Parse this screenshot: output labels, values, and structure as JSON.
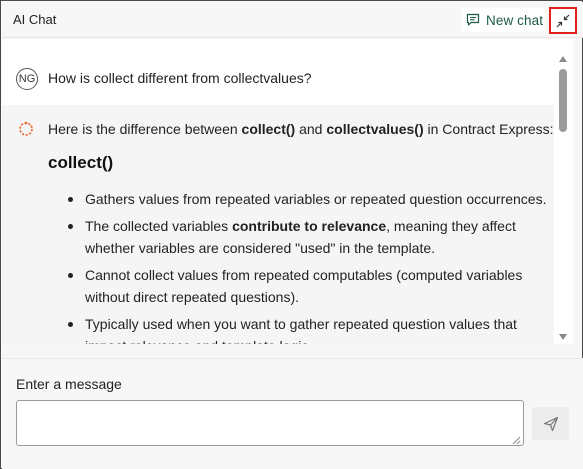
{
  "header": {
    "title": "AI Chat",
    "new_chat_label": "New chat",
    "new_chat_icon": "chat-bubble-icon",
    "collapse_icon": "collapse-arrows-icon"
  },
  "conversation": {
    "user": {
      "avatar_initials": "NG",
      "text": "How is collect different from collectvalues?"
    },
    "assistant": {
      "avatar_icon": "ai-spinner-icon",
      "intro_before": "Here is the difference between ",
      "intro_term1": "collect()",
      "intro_middle": " and ",
      "intro_term2": "collectvalues()",
      "intro_after": " in Contract Express:",
      "heading": "collect()",
      "bullets": [
        {
          "text": "Gathers values from repeated variables or repeated question occurrences."
        },
        {
          "before": "The collected variables ",
          "bold": "contribute to relevance",
          "after": ", meaning they affect whether variables are considered \"used\" in the template."
        },
        {
          "text": "Cannot collect values from repeated computables (computed variables without direct repeated questions)."
        },
        {
          "text": "Typically used when you want to gather repeated question values that impact relevance and template logic."
        }
      ]
    }
  },
  "composer": {
    "label": "Enter a message",
    "placeholder": "",
    "value": "",
    "send_icon": "send-icon"
  },
  "colors": {
    "accent_green": "#1c5c43",
    "highlight_red": "#e0201a",
    "ai_avatar_orange": "#e8652a"
  }
}
